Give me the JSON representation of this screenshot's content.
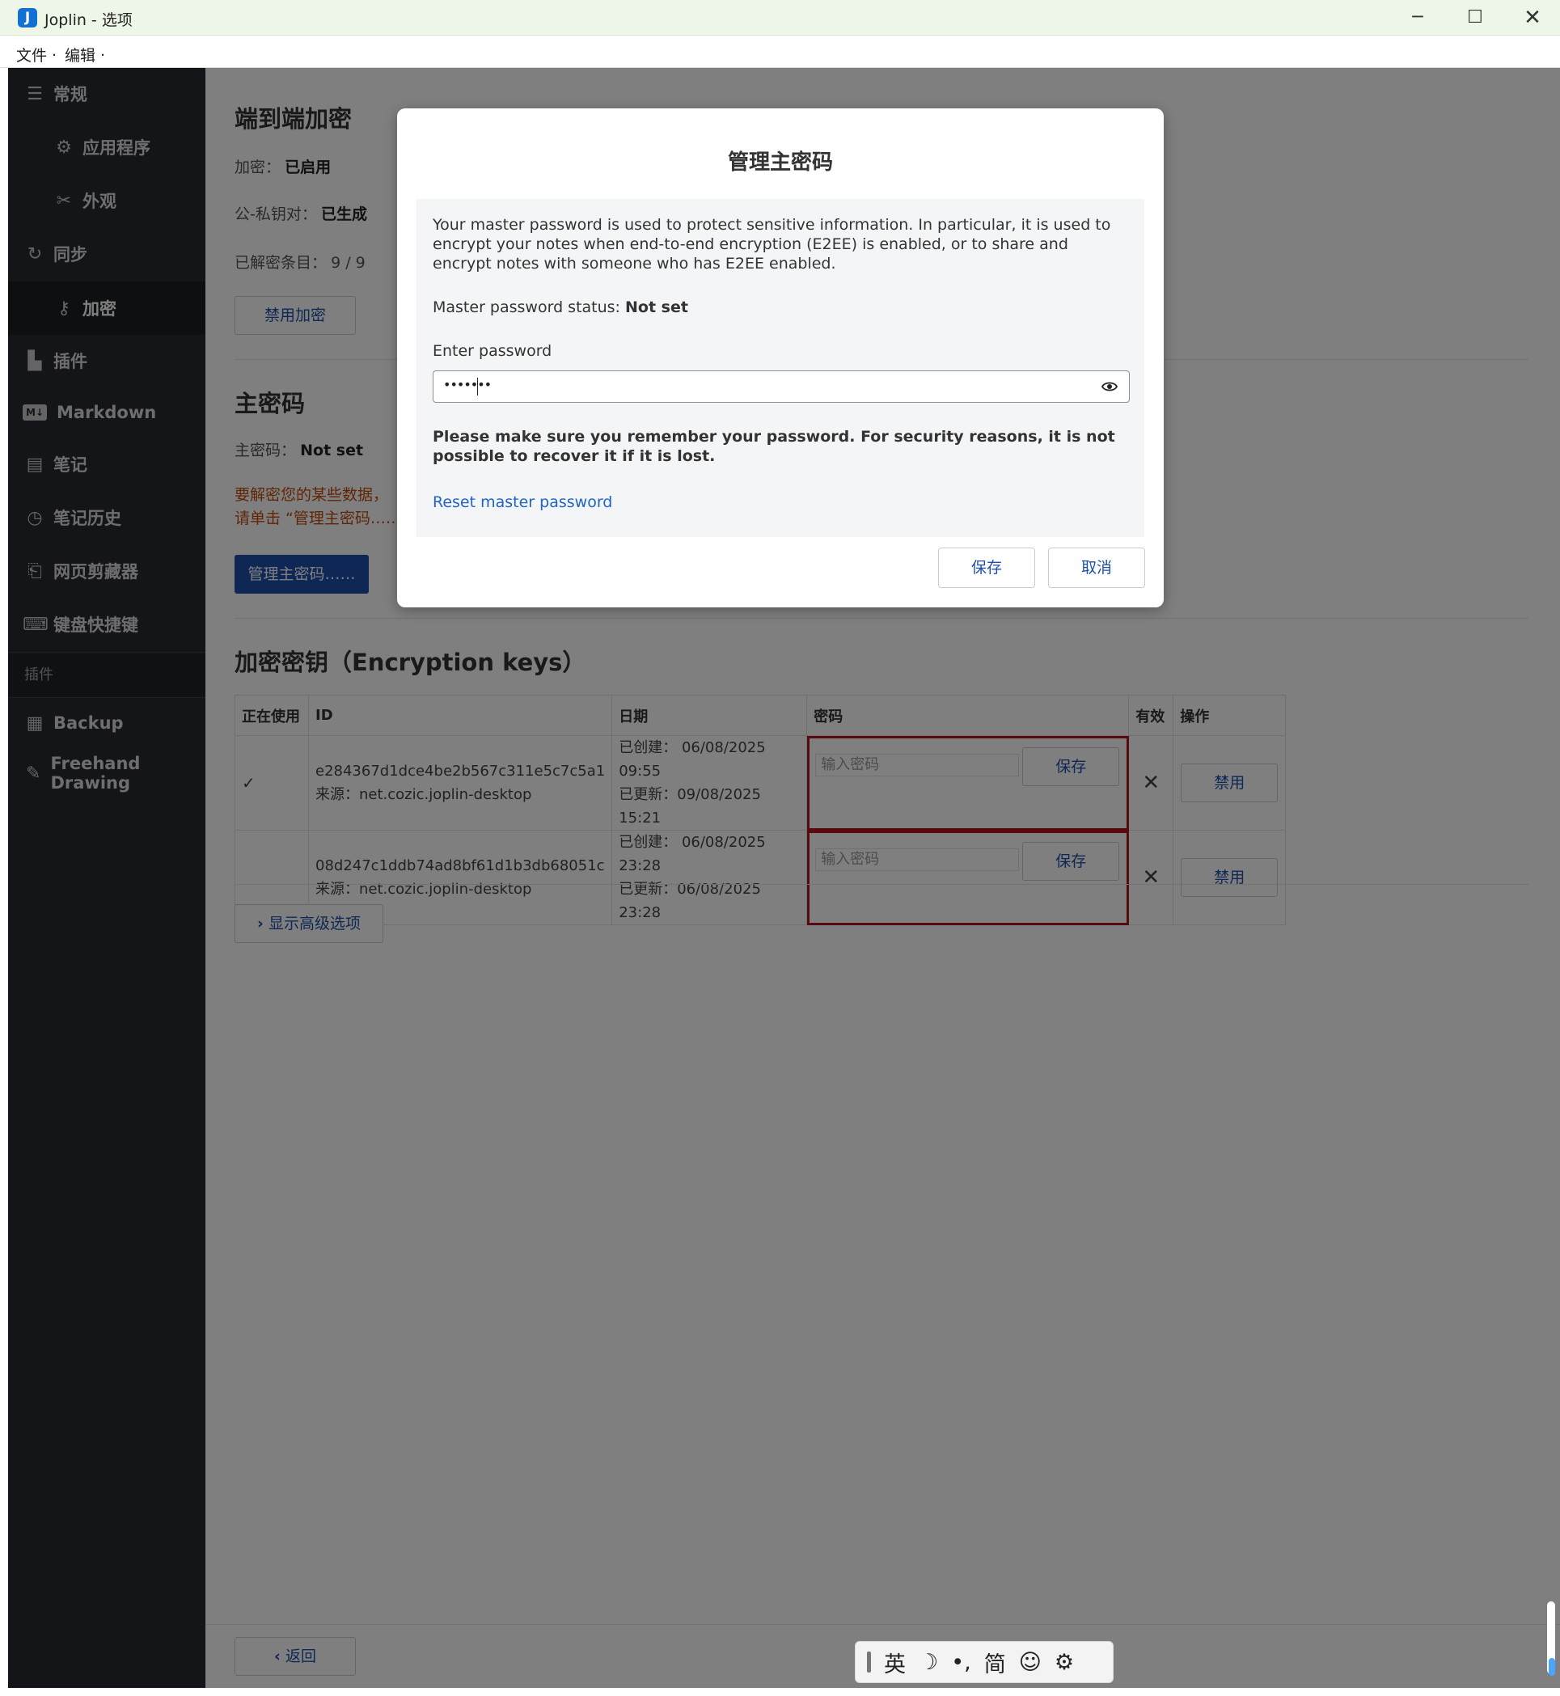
{
  "window": {
    "title": "Joplin - 选项",
    "icon_letter": "J",
    "minimize": "─",
    "maximize": "☐",
    "close": "✕"
  },
  "menu": {
    "file": "文件",
    "edit": "编辑"
  },
  "sidebar": {
    "items": [
      {
        "label": "常规",
        "icon": "sliders-icon"
      },
      {
        "label": "应用程序",
        "icon": "gear-icon"
      },
      {
        "label": "外观",
        "icon": "tools-icon"
      },
      {
        "label": "同步",
        "icon": "sync-icon"
      },
      {
        "label": "加密",
        "icon": "key-icon"
      },
      {
        "label": "插件",
        "icon": "puzzle-icon"
      },
      {
        "label": "Markdown",
        "icon": "markdown-icon"
      },
      {
        "label": "笔记",
        "icon": "note-icon"
      },
      {
        "label": "笔记历史",
        "icon": "history-icon"
      },
      {
        "label": "网页剪藏器",
        "icon": "clipper-icon"
      },
      {
        "label": "键盘快捷键",
        "icon": "keyboard-icon"
      }
    ],
    "section_plugins": "插件",
    "plugin_items": [
      {
        "label": "Backup",
        "icon": "archive-icon"
      },
      {
        "label": "Freehand Drawing",
        "icon": "pen-icon"
      }
    ]
  },
  "e2ee": {
    "title": "端到端加密",
    "encryption_label": "加密：",
    "encryption_value": "已启用",
    "keypair_label": "公-私钥对：",
    "keypair_value": "已生成",
    "decrypted_label": "已解密条目：",
    "decrypted_value": "9 / 9",
    "disable_button": "禁用加密"
  },
  "master": {
    "title": "主密码",
    "status_label": "主密码：",
    "status_value": "Not set",
    "warning_line1": "要解密您的某些数据，",
    "warning_line2": "请单击 “管理主密码……”",
    "manage_button": "管理主密码……"
  },
  "keys": {
    "title": "加密密钥（Encryption keys）",
    "headers": [
      "正在使用",
      "ID",
      "日期",
      "密码",
      "有效",
      "操作"
    ],
    "rows": [
      {
        "in_use": "✓",
        "id": "e284367d1dce4be2b567c311e5c7c5a1",
        "source": "来源：net.cozic.joplin-desktop",
        "created": "已创建：  06/08/2025 09:55",
        "updated": "已更新：09/08/2025 15:21",
        "password_placeholder": "输入密码",
        "save": "保存",
        "valid": "✕",
        "action": "禁用"
      },
      {
        "in_use": "",
        "id": "08d247c1ddb74ad8bf61d1b3db68051c",
        "source": "来源：net.cozic.joplin-desktop",
        "created": "已创建：  06/08/2025 23:28",
        "updated": "已更新：06/08/2025 23:28",
        "password_placeholder": "输入密码",
        "save": "保存",
        "valid": "✕",
        "action": "禁用"
      }
    ]
  },
  "advanced_button": "显示高级选项",
  "back_button": "返回",
  "dialog": {
    "title": "管理主密码",
    "description": "Your master password is used to protect sensitive information. In particular, it is used to encrypt your notes when end-to-end encryption (E2EE) is enabled, or to share and encrypt notes with someone who has E2EE enabled.",
    "status_label": "Master password status: ",
    "status_value": "Not set",
    "enter_label": "Enter password",
    "password_dots": "•••••••",
    "warning": "Please make sure you remember your password. For security reasons, it is not possible to recover it if it is lost.",
    "reset_link": "Reset master password",
    "save": "保存",
    "cancel": "取消"
  },
  "ime": {
    "lang": "英",
    "moon": "☽",
    "punct": "•,",
    "simplified": "简",
    "emoji": "☺",
    "settings": "⚙"
  },
  "colors": {
    "sidebar_bg": "#272b33",
    "accent": "#1f4fa8",
    "warning": "#c14b0d",
    "error": "#d0142d",
    "link": "#1f64c8"
  }
}
